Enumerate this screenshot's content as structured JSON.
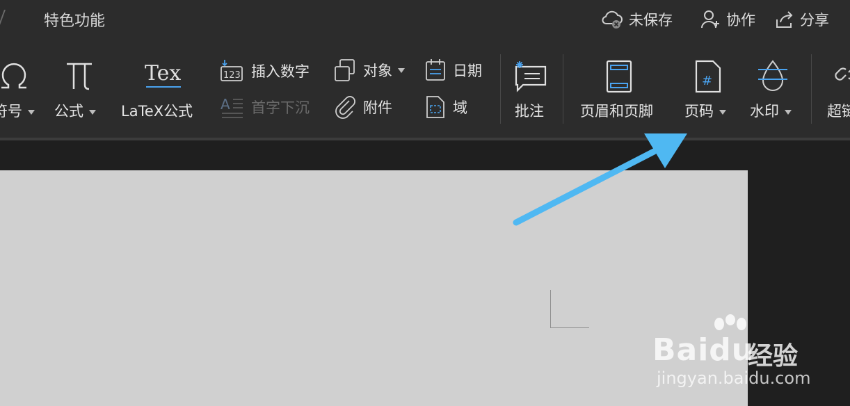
{
  "titlebar": {
    "tab_feature": "特色功能",
    "unsaved": "未保存",
    "collab": "协作",
    "share": "分享"
  },
  "ribbon": {
    "symbol": "符号",
    "formula": "公式",
    "latex_icon": "Tex",
    "latex": "LaTeX公式",
    "insert_number": "插入数字",
    "drop_cap": "首字下沉",
    "object": "对象",
    "attachment": "附件",
    "date": "日期",
    "field": "域",
    "comment": "批注",
    "header_footer": "页眉和页脚",
    "page_number": "页码",
    "watermark": "水印",
    "hyperlink": "超链"
  },
  "colors": {
    "accent": "#4aa3f0",
    "arrow": "#4fb8f2",
    "background": "#2a2a2a",
    "page": "#d0d0d0"
  },
  "watermark": {
    "logo_text": "Baidu",
    "brand_cn": "经验",
    "url": "jingyan.baidu.com"
  }
}
